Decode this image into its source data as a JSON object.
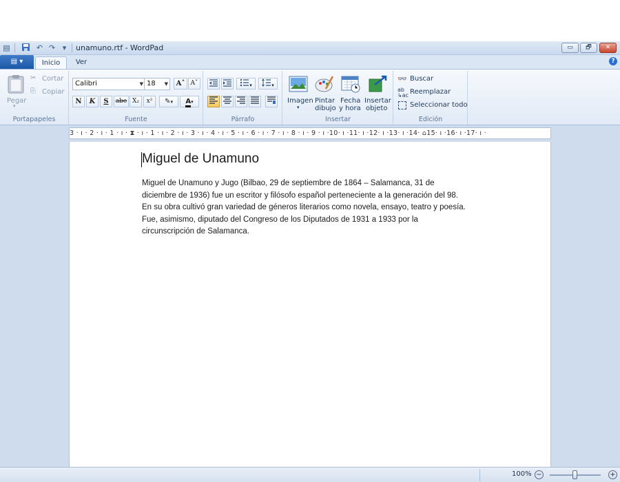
{
  "window": {
    "title": "unamuno.rtf - WordPad",
    "controls": {
      "minimize": "▭",
      "maximize": "🗗",
      "close": "✕"
    }
  },
  "quick_access": {
    "icons": [
      "app-icon",
      "save-icon",
      "undo-icon",
      "redo-icon",
      "customize-dropdown-icon"
    ],
    "dropdown_glyph": "▾"
  },
  "tabs": [
    {
      "label": "Inicio",
      "active": true
    },
    {
      "label": "Ver",
      "active": false
    }
  ],
  "app_menu_glyph": "▤ ▾",
  "help_glyph": "?",
  "ribbon": {
    "clipboard": {
      "paste_label": "Pegar",
      "cut_label": "Cortar",
      "copy_label": "Copiar",
      "group_label": "Portapapeles"
    },
    "font": {
      "family": "Calibri",
      "size": "18",
      "grow_glyph": "A˄",
      "shrink_glyph": "A˅",
      "bold_glyph": "N",
      "italic_glyph": "K",
      "underline_glyph": "S",
      "strike_glyph": "abe",
      "subscript_glyph": "X₂",
      "superscript_glyph": "x²",
      "highlight_glyph": "✎",
      "color_glyph": "A",
      "group_label": "Fuente"
    },
    "paragraph": {
      "group_label": "Párrafo",
      "align_active": "left"
    },
    "insert": {
      "image_label": "Imagen",
      "paint_label_1": "Pintar",
      "paint_label_2": "dibujo",
      "date_label_1": "Fecha",
      "date_label_2": "y hora",
      "object_label_1": "Insertar",
      "object_label_2": "objeto",
      "group_label": "Insertar"
    },
    "editing": {
      "find_label": "Buscar",
      "replace_label": "Reemplazar",
      "select_all_label": "Seleccionar todo",
      "group_label": "Edición"
    }
  },
  "ruler": {
    "text": "3 · ı · 2 · ı · 1 · ı · ⧗ · ı · 1 · ı · 2 · ı · 3 · ı · 4 · ı · 5 · ı · 6 · ı · 7 · ı · 8 · ı · 9 · ı ·10· ı ·11· ı ·12· ı ·13· ı ·14· ⌂15· ı ·16· ı ·17· ı ·"
  },
  "document": {
    "title": "Miguel de Unamuno",
    "lines": [
      "Miguel de Unamuno y Jugo (Bilbao, 29 de septiembre de 1864 – Salamanca, 31 de",
      "diciembre de 1936) fue un escritor y filósofo español perteneciente a la generación del 98.",
      "En su obra cultivó gran variedad de géneros literarios como novela, ensayo, teatro y poesía.",
      "Fue, asimismo, diputado del Congreso de los Diputados de 1931 a 1933 por la",
      "circunscripción de Salamanca."
    ]
  },
  "statusbar": {
    "zoom": "100%",
    "zoom_out_glyph": "−",
    "zoom_in_glyph": "+"
  },
  "colors": {
    "ribbon_bg": "#e1eaf6",
    "workspace_bg": "#cfdcee",
    "accent": "#1d59a9"
  }
}
